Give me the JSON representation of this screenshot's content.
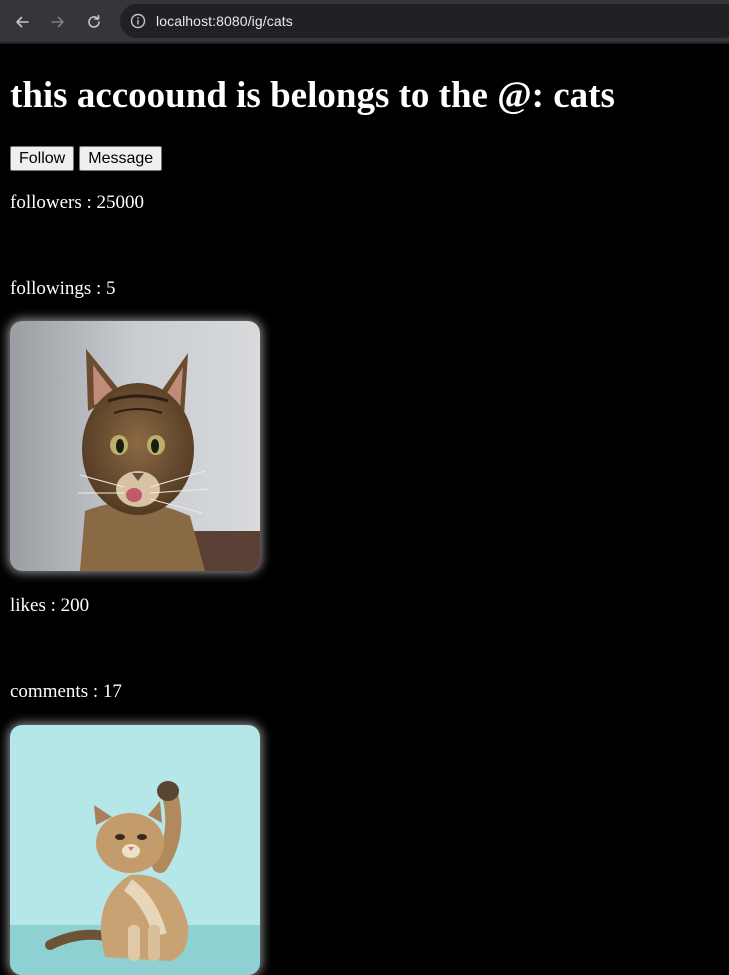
{
  "browser": {
    "url": "localhost:8080/ig/cats",
    "icons": {
      "back": "arrow-left-icon",
      "forward": "arrow-right-icon",
      "reload": "reload-icon",
      "info": "info-icon"
    }
  },
  "profile": {
    "heading": "this accoound is belongs to the @: cats",
    "follow_label": "Follow",
    "message_label": "Message",
    "followers": "followers : 25000",
    "followings": "followings : 5"
  },
  "posts": [
    {
      "image_subject": "tabby cat licking its nose",
      "likes": "likes : 200",
      "comments": "comments : 17"
    },
    {
      "image_subject": "kitten raising paw on teal background"
    }
  ],
  "colors": {
    "background": "#000000",
    "text": "#ffffff",
    "chrome": "#35363a",
    "urlbar": "#202124"
  }
}
